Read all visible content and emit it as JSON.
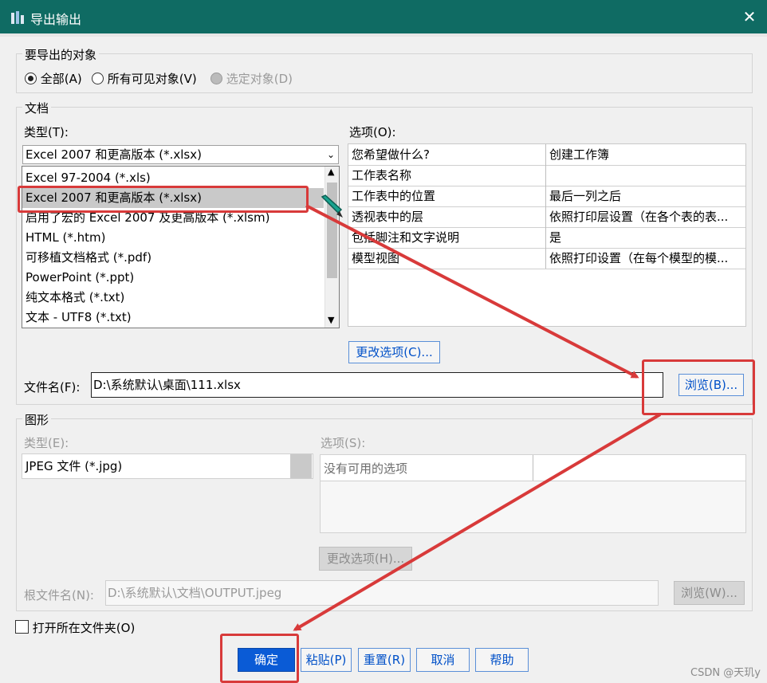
{
  "window": {
    "title": "导出输出",
    "close_glyph": "✕"
  },
  "objects_group": {
    "legend": "要导出的对象",
    "options": [
      {
        "label": "全部(A)",
        "checked": true,
        "enabled": true
      },
      {
        "label": "所有可见对象(V)",
        "checked": false,
        "enabled": true
      },
      {
        "label": "选定对象(D)",
        "checked": false,
        "enabled": false
      }
    ]
  },
  "document_group": {
    "legend": "文档",
    "type_label": "类型(T):",
    "type_value": "Excel 2007 和更高版本 (*.xlsx)",
    "type_list": [
      "Excel 97-2004 (*.xls)",
      "Excel 2007 和更高版本 (*.xlsx)",
      "启用了宏的 Excel 2007 及更高版本 (*.xlsm)",
      "HTML (*.htm)",
      "可移植文档格式 (*.pdf)",
      "PowerPoint (*.ppt)",
      "纯文本格式 (*.txt)",
      "文本 - UTF8 (*.txt)"
    ],
    "selected_index": 1,
    "options_label": "选项(O):",
    "options_rows": [
      [
        "您希望做什么?",
        "创建工作簿"
      ],
      [
        "工作表名称",
        ""
      ],
      [
        "工作表中的位置",
        "最后一列之后"
      ],
      [
        "透视表中的层",
        "依照打印层设置（在各个表的表..."
      ],
      [
        "包括脚注和文字说明",
        "是"
      ],
      [
        "模型视图",
        "依照打印设置（在每个模型的模..."
      ]
    ],
    "change_options_label": "更改选项(C)...",
    "filename_label": "文件名(F):",
    "filename_value": "D:\\系统默认\\桌面\\111.xlsx",
    "browse_label": "浏览(B)..."
  },
  "graphics_group": {
    "legend": "图形",
    "type_label": "类型(E):",
    "type_value": "JPEG 文件 (*.jpg)",
    "options_label": "选项(S):",
    "no_options_text": "没有可用的选项",
    "change_options_label": "更改选项(H)...",
    "root_filename_label": "根文件名(N):",
    "root_filename_value": "D:\\系统默认\\文档\\OUTPUT.jpeg",
    "browse_label": "浏览(W)..."
  },
  "open_folder_label": "打开所在文件夹(O)",
  "buttons": {
    "ok": "确定",
    "paste": "粘贴(P)",
    "reset": "重置(R)",
    "cancel": "取消",
    "help": "帮助"
  },
  "watermark": "CSDN @天玑y",
  "colors": {
    "titlebar": "#0f6b63",
    "annotation_red": "#d83a3a",
    "primary_button": "#0a5bd6"
  }
}
